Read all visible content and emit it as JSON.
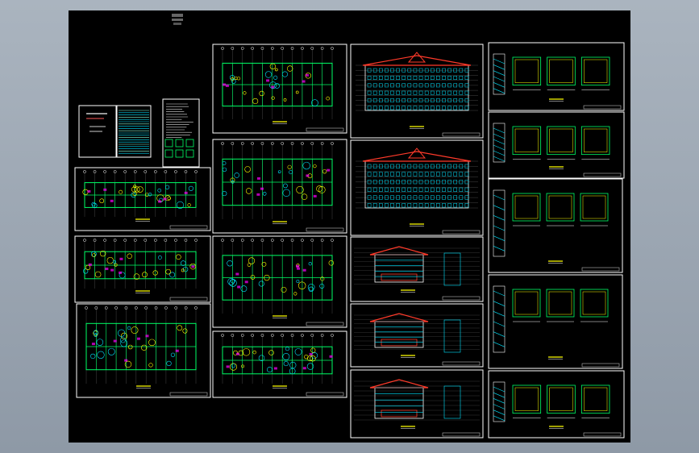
{
  "viewer": {
    "background_color": "#9aa5b1",
    "canvas_color": "#000000"
  },
  "sheet_colors": {
    "frame": "#ffffff",
    "wall": "#00ff66",
    "axis": "#ffffff",
    "furniture": "#00e5ff",
    "highlight": "#ffff00",
    "roof": "#ff3a2a",
    "accent": "#ff00ff",
    "dim": "#ffff66"
  },
  "sheets": [
    {
      "id": "cover-sheet",
      "kind": "cover"
    },
    {
      "id": "index-sheet",
      "kind": "table"
    },
    {
      "id": "notes-sheet",
      "kind": "notes"
    },
    {
      "id": "plan-1",
      "kind": "plan"
    },
    {
      "id": "plan-2",
      "kind": "plan"
    },
    {
      "id": "plan-3",
      "kind": "plan"
    },
    {
      "id": "plan-4",
      "kind": "plan"
    },
    {
      "id": "plan-5",
      "kind": "plan"
    },
    {
      "id": "plan-6",
      "kind": "plan"
    },
    {
      "id": "roof-plan",
      "kind": "roof"
    },
    {
      "id": "elevation-1",
      "kind": "elevation"
    },
    {
      "id": "elevation-2",
      "kind": "elevation"
    },
    {
      "id": "section-1",
      "kind": "section"
    },
    {
      "id": "section-2",
      "kind": "section"
    },
    {
      "id": "side-elevation",
      "kind": "side"
    },
    {
      "id": "detail-1",
      "kind": "detail"
    },
    {
      "id": "detail-2",
      "kind": "detail"
    },
    {
      "id": "detail-3",
      "kind": "detail"
    },
    {
      "id": "detail-4",
      "kind": "detail"
    },
    {
      "id": "detail-5",
      "kind": "detail"
    }
  ]
}
